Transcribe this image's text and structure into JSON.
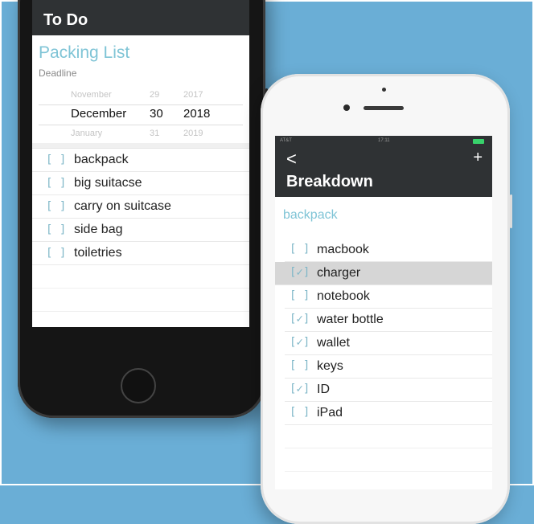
{
  "left_phone": {
    "nav_title": "To Do",
    "list_title": "Packing List",
    "deadline_label": "Deadline",
    "date_picker": {
      "prev": {
        "month": "November",
        "day": "29",
        "year": "2017"
      },
      "selected": {
        "month": "December",
        "day": "30",
        "year": "2018"
      },
      "next": {
        "month": "January",
        "day": "31",
        "year": "2019"
      }
    },
    "items": [
      {
        "check": "[ ]",
        "label": "backpack"
      },
      {
        "check": "[ ]",
        "label": "big suitacse"
      },
      {
        "check": "[ ]",
        "label": "carry on suitcase"
      },
      {
        "check": "[ ]",
        "label": "side bag"
      },
      {
        "check": "[ ]",
        "label": "toiletries"
      }
    ]
  },
  "right_phone": {
    "status": {
      "carrier": "AT&T",
      "time": "17:11"
    },
    "back_glyph": "<",
    "add_glyph": "+",
    "nav_title": "Breakdown",
    "parent_item": "backpack",
    "items": [
      {
        "check": "[ ]",
        "label": "macbook",
        "checked": false
      },
      {
        "check": "[✓]",
        "label": "charger",
        "checked": true
      },
      {
        "check": "[ ]",
        "label": "notebook",
        "checked": false
      },
      {
        "check": "[✓]",
        "label": "water bottle",
        "checked": true
      },
      {
        "check": "[✓]",
        "label": "wallet",
        "checked": true
      },
      {
        "check": "[ ]",
        "label": "keys",
        "checked": false
      },
      {
        "check": "[✓]",
        "label": "ID",
        "checked": true
      },
      {
        "check": "[ ]",
        "label": "iPad",
        "checked": false
      }
    ]
  },
  "colors": {
    "background": "#6aaed6",
    "navbar": "#2f3234",
    "accent": "#7fc4d6",
    "highlight_row": "#d6d6d6"
  }
}
